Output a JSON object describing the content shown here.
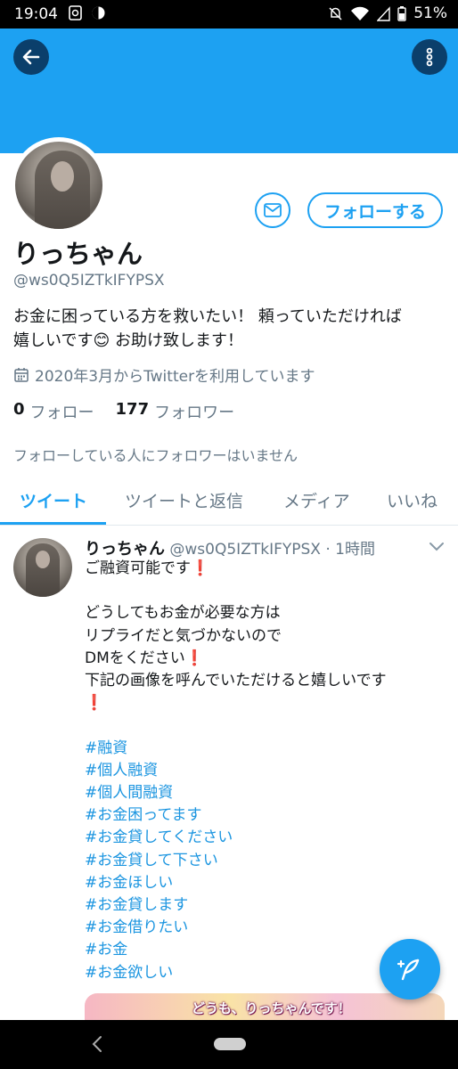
{
  "status_bar": {
    "time": "19:04",
    "battery": "51%"
  },
  "profile": {
    "name": "りっちゃん",
    "handle": "@ws0Q5IZTkIFYPSX",
    "bio_line1": "お金に困っている方を救いたい！ 頼っていただければ",
    "bio_line2_a": "嬉しいです",
    "bio_line2_emoji": "😊",
    "bio_line2_b": " お助け致します！",
    "joined": "2020年3月からTwitterを利用しています",
    "following_count": "0",
    "following_label": "フォロー",
    "followers_count": "177",
    "followers_label": "フォロワー",
    "no_mutual_followers": "フォローしている人にフォロワーはいません",
    "follow_button": "フォローする"
  },
  "tabs": [
    {
      "label": "ツイート",
      "active": true
    },
    {
      "label": "ツイートと返信",
      "active": false
    },
    {
      "label": "メディア",
      "active": false
    },
    {
      "label": "いいね",
      "active": false
    }
  ],
  "tweet": {
    "name": "りっちゃん",
    "handle": "@ws0Q5IZTkIFYPSX",
    "separator": "·",
    "time": "1時間",
    "lines": [
      "ご融資可能です",
      "",
      "どうしてもお金が必要な方は",
      "リプライだと気づかないので",
      "DMをください",
      "下記の画像を呼んでいただけると嬉しいです"
    ],
    "excl": "❗",
    "hashtags": [
      "#融資",
      "#個人融資",
      "#個人間融資",
      "#お金困ってます",
      "#お金貸してください",
      "#お金貸して下さい",
      "#お金ほしい",
      "#お金貸します",
      "#お金借りたい",
      "#お金",
      "#お金欲しい"
    ],
    "image_caption": "どうも、りっちゃんです！"
  },
  "colors": {
    "accent": "#1da1f2",
    "banner": "#1da1f2",
    "secondary_text": "#657786",
    "exclamation": "#e0245e"
  },
  "icons": [
    "back-arrow-icon",
    "more-vertical-icon",
    "mail-icon",
    "calendar-icon",
    "chevron-down-icon",
    "compose-icon",
    "wifi-icon",
    "battery-icon"
  ]
}
